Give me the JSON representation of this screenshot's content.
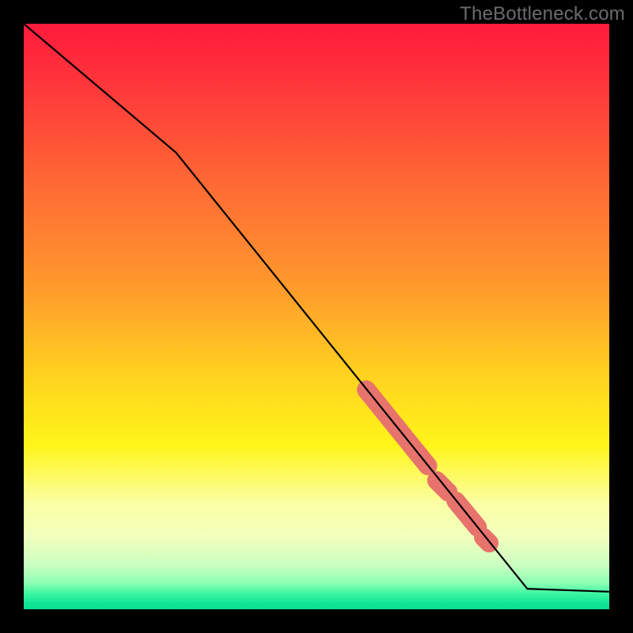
{
  "watermark_text": "TheBottleneck.com",
  "gradient": {
    "stops": [
      {
        "offset": 0.0,
        "color": "#ff1a3c"
      },
      {
        "offset": 0.12,
        "color": "#ff3b3a"
      },
      {
        "offset": 0.28,
        "color": "#ff6b34"
      },
      {
        "offset": 0.45,
        "color": "#ff9a2c"
      },
      {
        "offset": 0.6,
        "color": "#ffd21f"
      },
      {
        "offset": 0.72,
        "color": "#fff51a"
      },
      {
        "offset": 0.82,
        "color": "#fbffa6"
      },
      {
        "offset": 0.88,
        "color": "#f0ffbe"
      },
      {
        "offset": 0.925,
        "color": "#caffc0"
      },
      {
        "offset": 0.955,
        "color": "#8dffb4"
      },
      {
        "offset": 0.975,
        "color": "#36f4a0"
      },
      {
        "offset": 0.99,
        "color": "#12e696"
      },
      {
        "offset": 1.0,
        "color": "#0adf91"
      }
    ]
  },
  "chart_data": {
    "type": "line",
    "title": "",
    "xlabel": "",
    "ylabel": "",
    "xlim": [
      0,
      100
    ],
    "ylim": [
      0,
      100
    ],
    "series": [
      {
        "name": "curve",
        "x": [
          0,
          26,
          86,
          100
        ],
        "y": [
          100,
          78,
          3.5,
          3.0
        ]
      }
    ],
    "highlight_segments": [
      {
        "x0": 58.5,
        "y0": 37.5,
        "x1": 69.0,
        "y1": 24.5,
        "width": 3.2
      },
      {
        "x0": 70.5,
        "y0": 22.0,
        "x1": 72.5,
        "y1": 20.0,
        "width": 3.2
      },
      {
        "x0": 73.8,
        "y0": 18.5,
        "x1": 77.5,
        "y1": 14.0,
        "width": 3.2
      },
      {
        "x0": 78.5,
        "y0": 12.3,
        "x1": 79.5,
        "y1": 11.3,
        "width": 3.2
      }
    ],
    "highlight_color": "#e7736c"
  }
}
